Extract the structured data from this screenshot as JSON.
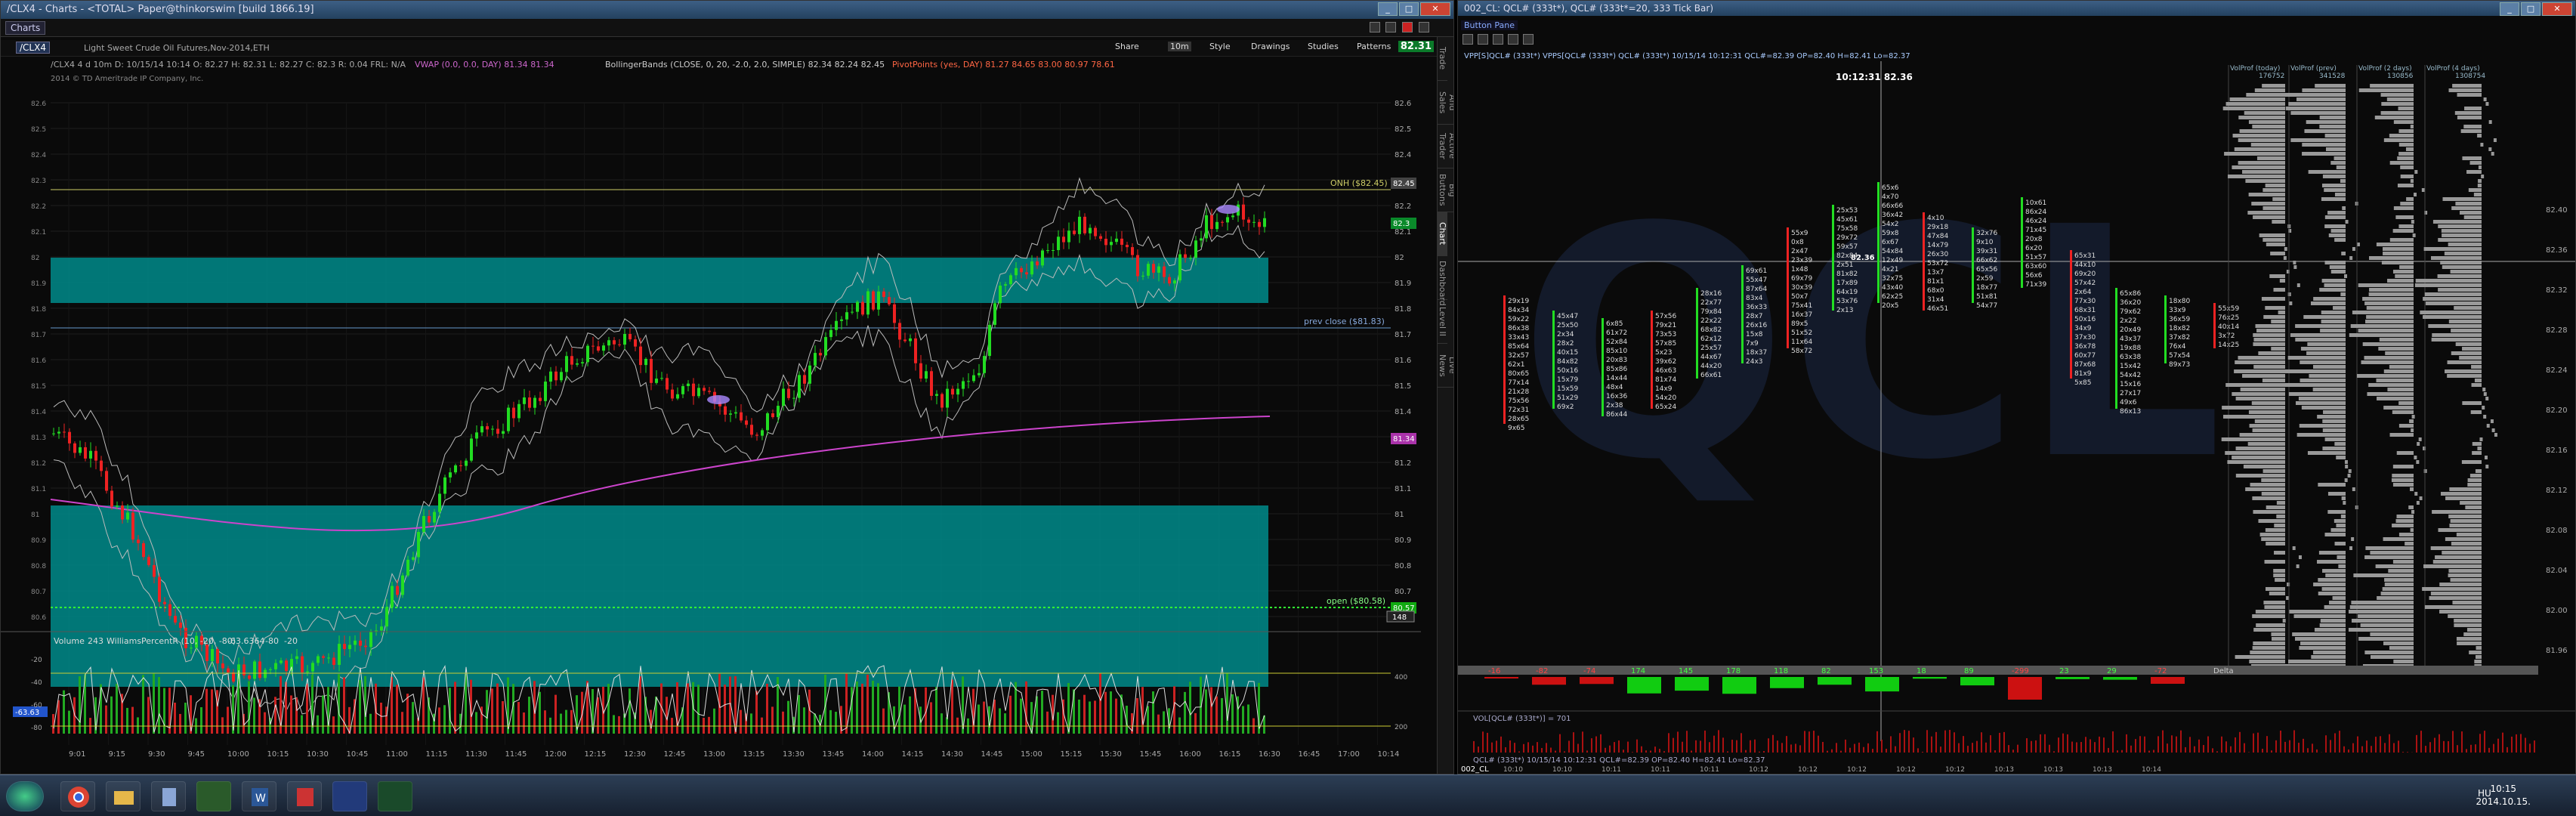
{
  "tos": {
    "title": "/CLX4 - Charts - <TOTAL> Paper@thinkorswim [build 1866.19]",
    "tab_charts": "Charts",
    "symbol": "/CLX4",
    "description": "Light Sweet Crude Oil Futures,Nov-2014,ETH",
    "toolbar": [
      "Share",
      "10m",
      "Style",
      "Drawings",
      "Studies",
      "Patterns"
    ],
    "quote_line": "/CLX4 4 d 10m  D: 10/15/14 10:14  O: 82.27  H: 82.31  L: 82.27  C: 82.3  R: 0.04  FRL: N/A",
    "vwap_label": "VWAP (0.0, 0.0, DAY)",
    "vwap_vals": [
      "81.34",
      "81.34"
    ],
    "bollinger_label": "BollingerBands (CLOSE, 0, 20, -2.0, 2.0, SIMPLE)",
    "bollinger_vals": [
      "82.34",
      "82.24",
      "82.45"
    ],
    "pivot_label": "PivotPoints (yes, DAY)",
    "pivot_vals": [
      "81.27",
      "84.65",
      "83.00",
      "80.97",
      "78.61"
    ],
    "copyright": "2014 © TD Ameritrade IP Company, Inc.",
    "last_price": "82.31",
    "ann_onh": "ONH ($82.45)",
    "ann_prevclose": "prev close ($81.83)",
    "ann_open": "open ($80.58)",
    "price_tag_right": "82.3",
    "vwap_tag": "81.34",
    "open_tag": "80.57",
    "volume_label": "Volume",
    "volume_val": "243",
    "williams_label": "WilliamsPercentR (10, -20, -80)",
    "williams_vals": [
      "-63.6364",
      "-80",
      "-20"
    ],
    "osc_box": "-63.63",
    "vol_box": "148",
    "sidebar": [
      "Trade",
      "Times And Sales",
      "Active Trader",
      "Big Buttons",
      "Chart",
      "Dashboard",
      "Level II",
      "Live News"
    ],
    "y_ticks": [
      "82.6",
      "82.5",
      "82.4",
      "82.3",
      "82.2",
      "82.1",
      "82",
      "81.9",
      "81.8",
      "81.7",
      "81.6",
      "81.5",
      "81.4",
      "81.3",
      "81.2",
      "81.1",
      "81",
      "80.9",
      "80.8",
      "80.7",
      "80.6"
    ],
    "osc_ticks": [
      "-20",
      "-40",
      "-60",
      "-80"
    ],
    "vol_ticks": [
      "400",
      "200"
    ],
    "x_ticks": [
      "9:01",
      "9:15",
      "9:30",
      "9:45",
      "10:00",
      "10:15",
      "10:30",
      "10:45",
      "11:00",
      "11:15",
      "11:30",
      "11:45",
      "12:00",
      "12:15",
      "12:30",
      "12:45",
      "13:00",
      "13:15",
      "13:30",
      "13:45",
      "14:00",
      "14:15",
      "14:30",
      "14:45",
      "15:00",
      "15:15",
      "15:30",
      "15:45",
      "16:00",
      "16:15",
      "16:30",
      "16:45",
      "17:00",
      "10:14"
    ]
  },
  "qcl": {
    "title": "002_CL: QCL# (333t*), QCL# (333t*=20, 333 Tick Bar)",
    "button_pane": "Button Pane",
    "legend": "VPP[S]QCL# (333t*)  VPPS[QCL# (333t*)  QCL# (333t*) 10/15/14 10:12:31 QCL#=82.39 OP=82.40 H=82.41 Lo=82.37",
    "cursor": "10:12:31 82.36",
    "price_cursor": "82.36",
    "vp_headers": [
      [
        "VolProf (today)",
        "176752"
      ],
      [
        "VolProf (prev)",
        "341528"
      ],
      [
        "VolProf (2 days)",
        "130856"
      ],
      [
        "VolProf (4 days)",
        "1308754"
      ]
    ],
    "y_ticks": [
      "82.40",
      "82.36",
      "82.32",
      "82.28",
      "82.24",
      "82.20",
      "82.16",
      "82.12",
      "82.08",
      "82.04",
      "82.00",
      "81.96"
    ],
    "delta_vals": [
      "-16",
      "-82",
      "-74",
      "174",
      "145",
      "178",
      "118",
      "82",
      "153",
      "18",
      "89",
      "-299",
      "23",
      "29",
      "-72"
    ],
    "delta_label": "Delta",
    "vol_label": "VOL[QCL# (333t*)] = 701",
    "bottom_label": "QCL# (333t*) 10/15/14 10:12:31 QCL#=82.39 OP=82.40 H=82.41 Lo=82.37",
    "x_ticks": [
      "10:10",
      "10:10",
      "10:11",
      "10:11",
      "10:11",
      "10:12",
      "10:12",
      "10:12",
      "10:12",
      "10:12",
      "10:13",
      "10:13",
      "10:13",
      "10:14"
    ],
    "tab_name": "002_CL",
    "watermark": "QCL"
  },
  "taskbar": {
    "lang": "HU",
    "time": "10:15",
    "date": "2014.10.15."
  },
  "colors": {
    "accent": "#008b8b",
    "up": "#22dd22",
    "down": "#ee2222",
    "vwap": "#cc44cc"
  }
}
